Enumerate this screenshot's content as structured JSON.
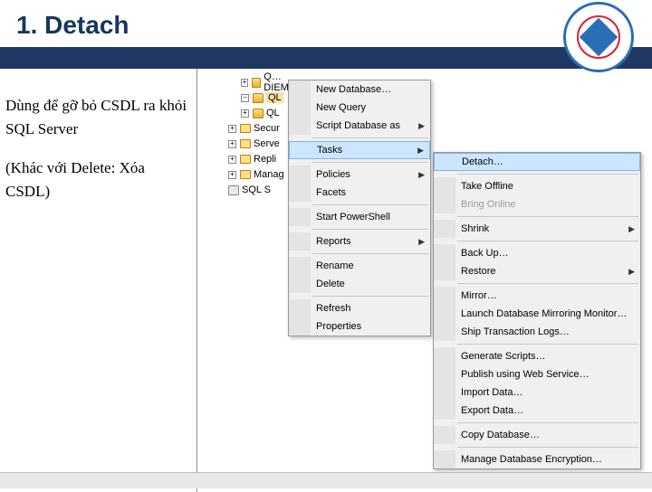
{
  "slide": {
    "title": "1. Detach"
  },
  "left": {
    "p1": "Dùng để gỡ bỏ CSDL ra khỏi SQL Server",
    "p2": "(Khác với Delete: Xóa CSDL)"
  },
  "tree": {
    "item0": "Q…DIEMTHISV",
    "item1_sel": "QL",
    "item2": "QL",
    "item3": "Secur",
    "item4": "Serve",
    "item5": "Repli",
    "item6": "Manag",
    "item7": "SQL S"
  },
  "menu1": {
    "new_db": "New Database…",
    "new_query": "New Query",
    "script_db": "Script Database as",
    "tasks": "Tasks",
    "policies": "Policies",
    "facets": "Facets",
    "powershell": "Start PowerShell",
    "reports": "Reports",
    "rename": "Rename",
    "delete": "Delete",
    "refresh": "Refresh",
    "properties": "Properties"
  },
  "menu2": {
    "detach": "Detach…",
    "take_offline": "Take Offline",
    "bring_online": "Bring Online",
    "shrink": "Shrink",
    "backup": "Back Up…",
    "restore": "Restore",
    "mirror": "Mirror…",
    "launch_mirror": "Launch Database Mirroring Monitor…",
    "ship_logs": "Ship Transaction Logs…",
    "gen_scripts": "Generate Scripts…",
    "publish_ws": "Publish using Web Service…",
    "import": "Import Data…",
    "export": "Export Data…",
    "copy_db": "Copy Database…",
    "manage_enc": "Manage Database Encryption…"
  }
}
